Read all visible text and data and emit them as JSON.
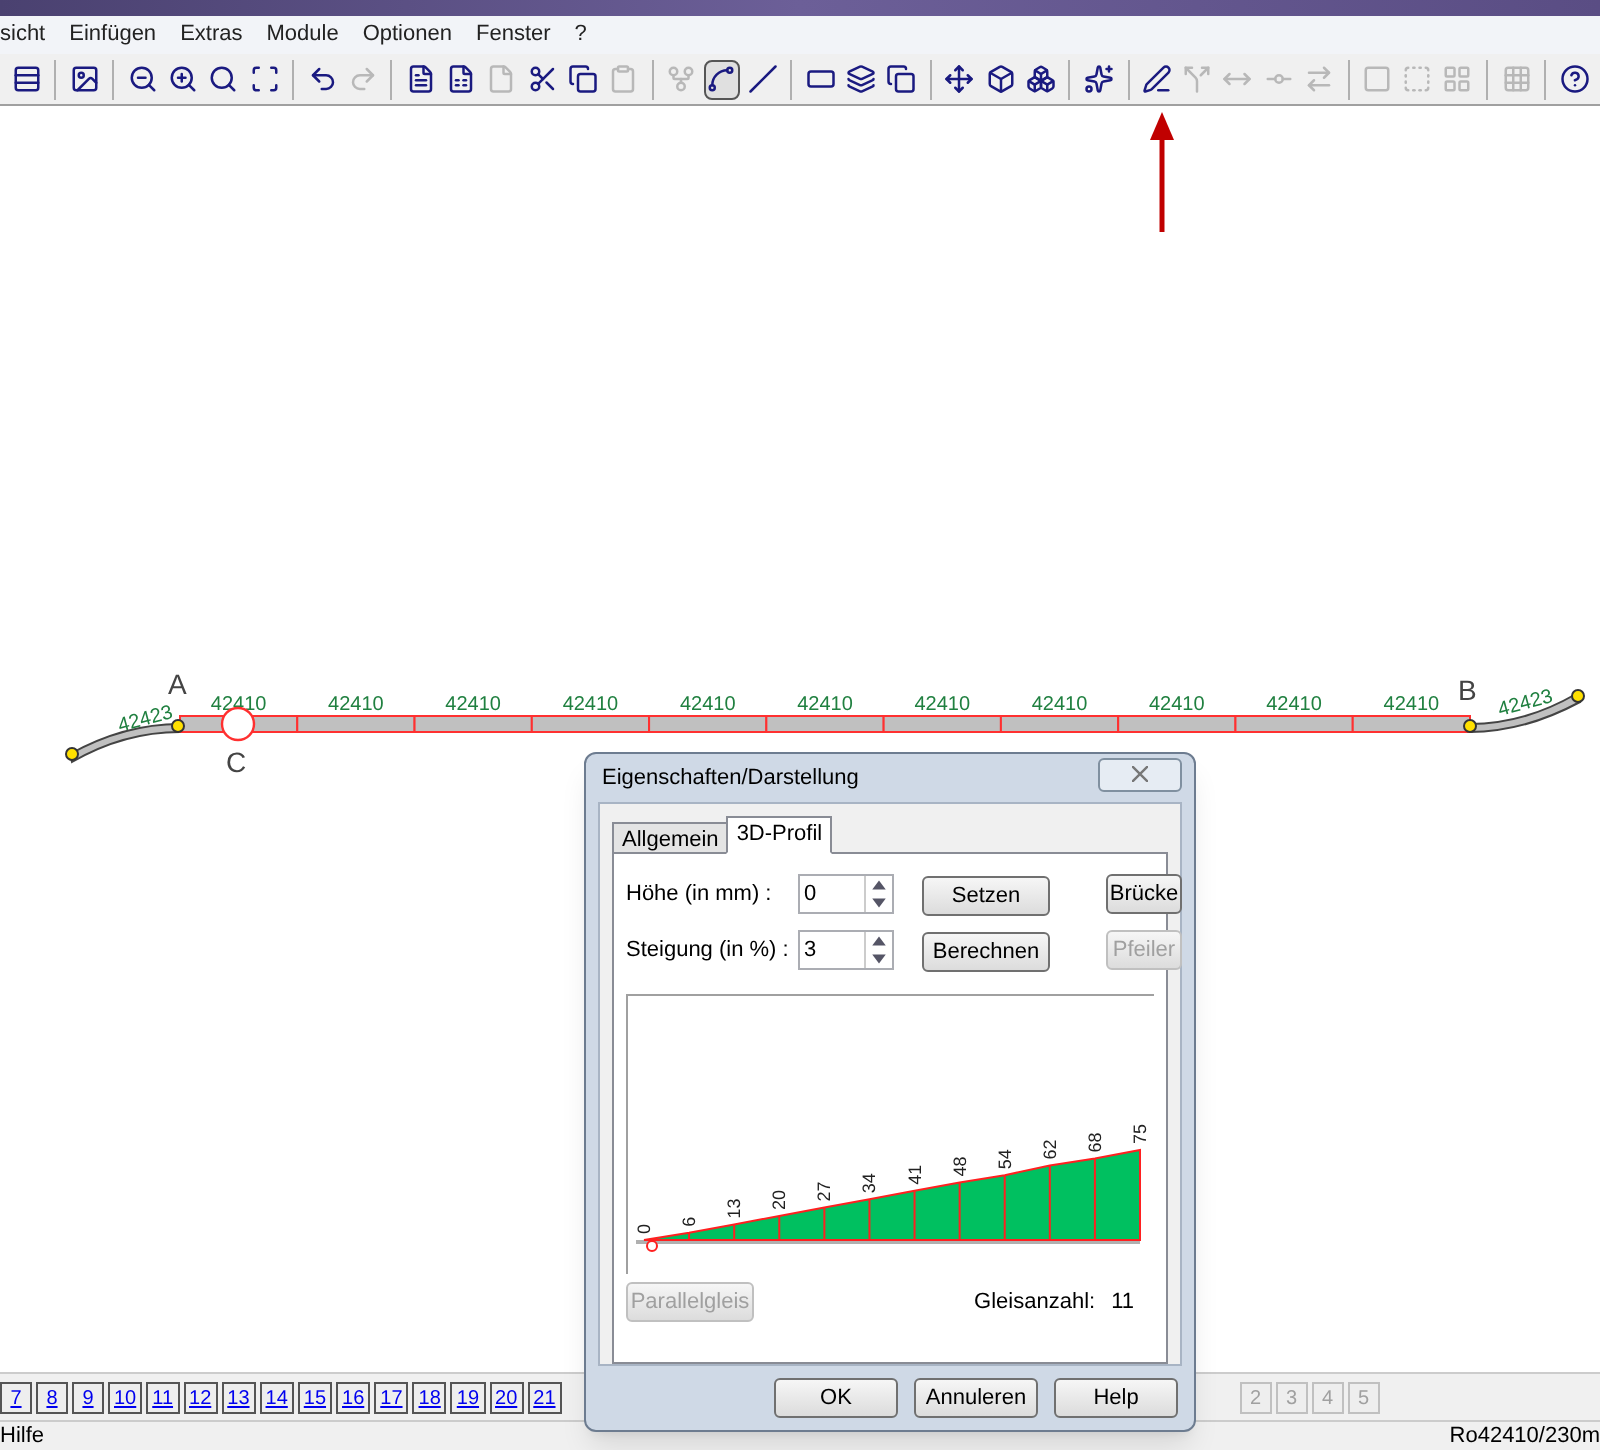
{
  "menu": [
    "sicht",
    "Einfügen",
    "Extras",
    "Module",
    "Optionen",
    "Fenster",
    "?"
  ],
  "toolbar": [
    {
      "kind": "button",
      "disabled": false,
      "pressed": false
    },
    {
      "kind": "separator"
    },
    {
      "kind": "button",
      "disabled": false,
      "pressed": false
    },
    {
      "kind": "separator"
    },
    {
      "kind": "button",
      "disabled": false,
      "pressed": false
    },
    {
      "kind": "button",
      "disabled": false,
      "pressed": false
    },
    {
      "kind": "button",
      "disabled": false,
      "pressed": false
    },
    {
      "kind": "button",
      "disabled": false,
      "pressed": false
    },
    {
      "kind": "separator"
    },
    {
      "kind": "button",
      "disabled": false,
      "pressed": false
    },
    {
      "kind": "button",
      "disabled": true,
      "pressed": false
    },
    {
      "kind": "separator"
    },
    {
      "kind": "button",
      "disabled": false,
      "pressed": false
    },
    {
      "kind": "button",
      "disabled": false,
      "pressed": false
    },
    {
      "kind": "button",
      "disabled": true,
      "pressed": false
    },
    {
      "kind": "button",
      "disabled": false,
      "pressed": false
    },
    {
      "kind": "button",
      "disabled": false,
      "pressed": false
    },
    {
      "kind": "button",
      "disabled": true,
      "pressed": false
    },
    {
      "kind": "separator"
    },
    {
      "kind": "button",
      "disabled": true,
      "pressed": false
    },
    {
      "kind": "button",
      "disabled": false,
      "pressed": true
    },
    {
      "kind": "button",
      "disabled": false,
      "pressed": false
    },
    {
      "kind": "separator"
    },
    {
      "kind": "button",
      "disabled": false,
      "pressed": false
    },
    {
      "kind": "button",
      "disabled": false,
      "pressed": false
    },
    {
      "kind": "button",
      "disabled": false,
      "pressed": false
    },
    {
      "kind": "separator"
    },
    {
      "kind": "button",
      "disabled": false,
      "pressed": false
    },
    {
      "kind": "button",
      "disabled": false,
      "pressed": false
    },
    {
      "kind": "button",
      "disabled": false,
      "pressed": false
    },
    {
      "kind": "separator"
    },
    {
      "kind": "button",
      "disabled": false,
      "pressed": false
    },
    {
      "kind": "separator"
    },
    {
      "kind": "button",
      "disabled": false,
      "pressed": false
    },
    {
      "kind": "button",
      "disabled": true,
      "pressed": false
    },
    {
      "kind": "button",
      "disabled": true,
      "pressed": false
    },
    {
      "kind": "button",
      "disabled": true,
      "pressed": false
    },
    {
      "kind": "button",
      "disabled": true,
      "pressed": false
    },
    {
      "kind": "separator"
    },
    {
      "kind": "button",
      "disabled": true,
      "pressed": false
    },
    {
      "kind": "button",
      "disabled": true,
      "pressed": false
    },
    {
      "kind": "button",
      "disabled": true,
      "pressed": false
    },
    {
      "kind": "separator"
    },
    {
      "kind": "button",
      "disabled": true,
      "pressed": false
    },
    {
      "kind": "separator"
    },
    {
      "kind": "button",
      "disabled": false,
      "pressed": false
    }
  ],
  "track": {
    "end_labels": [
      "A",
      "B"
    ],
    "marker_label": "C",
    "curve_labels": [
      "42423",
      "42423"
    ],
    "segment_labels": [
      "42410",
      "42410",
      "42410",
      "42410",
      "42410",
      "42410",
      "42410",
      "42410",
      "42410",
      "42410",
      "42410"
    ]
  },
  "dialog": {
    "title": "Eigenschaften/Darstellung",
    "tabs": [
      {
        "label": "Allgemein",
        "selected": false
      },
      {
        "label": "3D-Profil",
        "selected": true
      }
    ],
    "fields": [
      {
        "label": "Höhe (in mm) :",
        "value": "0"
      },
      {
        "label": "Steigung (in %) :",
        "value": "3"
      }
    ],
    "actions": [
      {
        "label": "Setzen",
        "disabled": false
      },
      {
        "label": "Brücke",
        "disabled": false
      },
      {
        "label": "Berechnen",
        "disabled": false
      },
      {
        "label": "Pfeiler",
        "disabled": true
      }
    ],
    "chart_data": {
      "type": "area",
      "categories": [
        null,
        null,
        null,
        null,
        null,
        null,
        null,
        null,
        null,
        null,
        null,
        null
      ],
      "grid": true,
      "series": [
        {
          "color": "#00c060",
          "values": [
            0,
            6,
            13,
            20,
            27,
            34,
            41,
            48,
            54,
            62,
            68,
            75
          ]
        }
      ],
      "data_labels": true
    },
    "parallel_button": {
      "label": "Parallelgleis",
      "disabled": true
    },
    "count_label": "Gleisanzahl:",
    "count_value": "11",
    "buttons": [
      "OK",
      "Annuleren",
      "Help"
    ]
  },
  "page_tabs": [
    {
      "label": "7",
      "disabled": false
    },
    {
      "label": "8",
      "disabled": false
    },
    {
      "label": "9",
      "disabled": false
    },
    {
      "label": "10",
      "disabled": false
    },
    {
      "label": "11",
      "disabled": false
    },
    {
      "label": "12",
      "disabled": false
    },
    {
      "label": "13",
      "disabled": false
    },
    {
      "label": "14",
      "disabled": false
    },
    {
      "label": "15",
      "disabled": false
    },
    {
      "label": "16",
      "disabled": false
    },
    {
      "label": "17",
      "disabled": false
    },
    {
      "label": "18",
      "disabled": false
    },
    {
      "label": "19",
      "disabled": false
    },
    {
      "label": "20",
      "disabled": false
    },
    {
      "label": "21",
      "disabled": false
    }
  ],
  "page_tabs_right": [
    {
      "label": "2",
      "disabled": true
    },
    {
      "label": "3",
      "disabled": true
    },
    {
      "label": "4",
      "disabled": true
    },
    {
      "label": "5",
      "disabled": true
    }
  ],
  "status_bar": {
    "left": "Hilfe",
    "right": "Ro42410/230m"
  }
}
